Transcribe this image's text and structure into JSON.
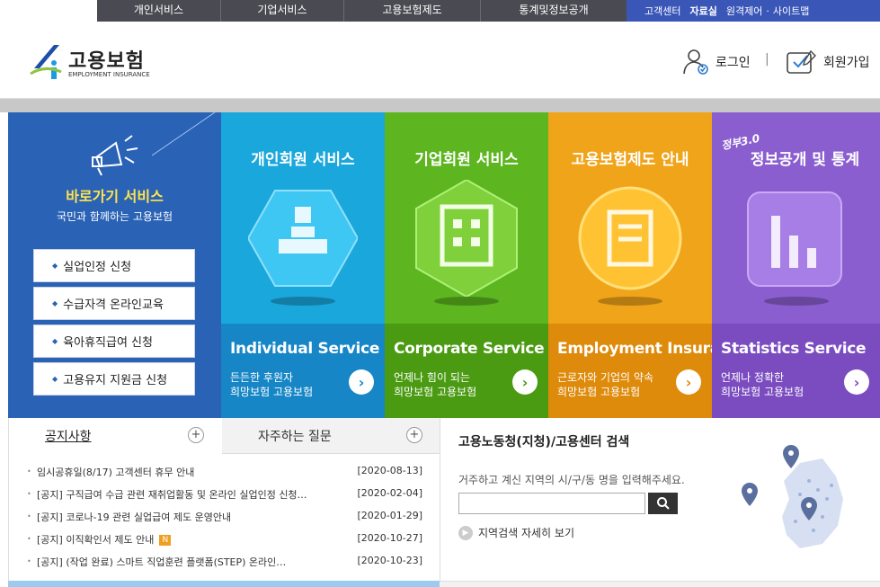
{
  "topnav": {
    "main": [
      "개인서비스",
      "기업서비스",
      "고용보험제도",
      "통계및정보공개"
    ],
    "util": [
      "고객센터",
      "자료실",
      "원격제어",
      "·",
      "사이트맵"
    ]
  },
  "header": {
    "logo_ko": "고용보험",
    "logo_en": "EMPLOYMENT INSURANCE",
    "login": "로그인",
    "separator": "|",
    "join": "회원가입"
  },
  "quick": {
    "title": "바로가기 서비스",
    "subtitle": "국민과 함께하는 고용보험",
    "items": [
      "실업인정 신청",
      "수급자격 온라인교육",
      "육아휴직급여 신청",
      "고용유지 지원금 신청"
    ]
  },
  "services": [
    {
      "title": "개인회원 서비스",
      "en": "Individual Service",
      "d1": "든든한 후원자",
      "d2": "희망보험 고용보험",
      "color": "#1aa7dc",
      "lower": "#1786c6"
    },
    {
      "title": "기업회원 서비스",
      "en": "Corporate Service",
      "d1": "언제나 힘이 되는",
      "d2": "희망보험 고용보험",
      "color": "#5db51f",
      "lower": "#4a9a12"
    },
    {
      "title": "고용보험제도 안내",
      "en": "Employment Insurance",
      "d1": "근로자와 기업의 약속",
      "d2": "희망보험 고용보험",
      "color": "#f0a41a",
      "lower": "#de8a0a"
    },
    {
      "title": "정보공개 및 통계",
      "badge": "정부3.0",
      "en": "Statistics Service",
      "d1": "언제나 정확한",
      "d2": "희망보험 고용보험",
      "color": "#8a5ecf",
      "lower": "#7a4cc0"
    }
  ],
  "notice": {
    "tab1": "공지사항",
    "tab2": "자주하는 질문",
    "items": [
      {
        "text": "임시공휴일(8/17) 고객센터 휴무 안내",
        "date": "[2020-08-13]",
        "new": ""
      },
      {
        "text": "[공지] 구직급여 수급 관련 재취업활동 및 온라인 실업인정 신청…",
        "date": "[2020-02-04]",
        "new": ""
      },
      {
        "text": "[공지] 코로나-19 관련 실업급여 제도 운영안내",
        "date": "[2020-01-29]",
        "new": ""
      },
      {
        "text": "[공지] 이직확인서 제도 안내",
        "date": "[2020-10-27]",
        "new": "N"
      },
      {
        "text": "[공지] (작업 완료) 스마트 직업훈련 플랫폼(STEP) 온라인…",
        "date": "[2020-10-23]",
        "new": ""
      }
    ]
  },
  "search": {
    "title": "고용노동청(지청)/고용센터 검색",
    "hint": "거주하고 계신 지역의 시/구/동 명을 입력해주세요.",
    "input_value": "",
    "detail": "지역검색 자세히 보기"
  }
}
